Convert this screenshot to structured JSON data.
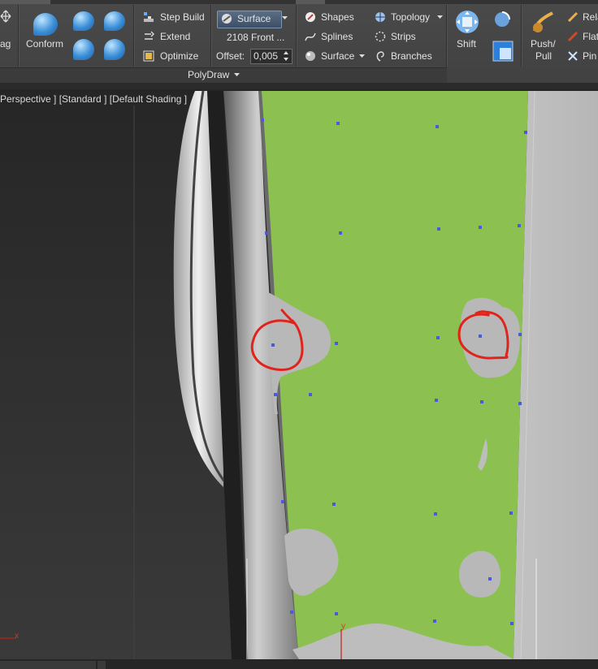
{
  "ribbon": {
    "left_partial_label": "ag",
    "conform_label": "Conform",
    "step_build_label": "Step Build",
    "extend_label": "Extend",
    "optimize_label": "Optimize",
    "surface_dropdown_value": "Surface",
    "surface_target_name": "2108 Front ...",
    "offset_label": "Offset:",
    "offset_value": "0,005",
    "shapes_label": "Shapes",
    "splines_label": "Splines",
    "surface_label": "Surface",
    "topology_label": "Topology",
    "strips_label": "Strips",
    "branches_label": "Branches",
    "shift_label": "Shift",
    "push_pull_line1": "Push/",
    "push_pull_line2": "Pull",
    "relax_partial": "Rela",
    "flatten_partial": "Flat",
    "pinch_partial": "Pin",
    "group_label": "PolyDraw"
  },
  "viewport": {
    "label": "Perspective ] [Standard ] [Default Shading ]",
    "axis_x": "x",
    "axis_y": "y"
  },
  "colors": {
    "green_surface": "#8cc152",
    "gray_mesh": "#b8b8b8",
    "annotation_red": "#e0241c",
    "vertex_blue": "#4a5ad8"
  },
  "icons": [
    "move-icon",
    "conform-icon",
    "step-build-icon",
    "extend-icon",
    "optimize-icon",
    "shapes-icon",
    "splines-icon",
    "surface-icon",
    "topology-icon",
    "strips-icon",
    "branches-icon",
    "shift-icon",
    "push-pull-icon",
    "relax-icon",
    "flatten-icon",
    "pinch-icon"
  ]
}
